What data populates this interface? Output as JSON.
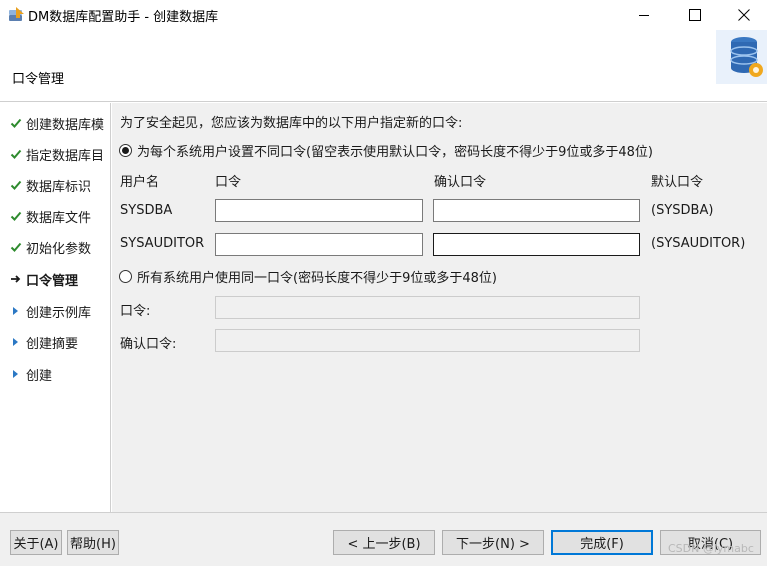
{
  "window": {
    "title": "DM数据库配置助手 - 创建数据库",
    "header_title": "口令管理"
  },
  "sidebar": {
    "steps": [
      {
        "label": "创建数据库模",
        "state": "done"
      },
      {
        "label": "指定数据库目",
        "state": "done"
      },
      {
        "label": "数据库标识",
        "state": "done"
      },
      {
        "label": "数据库文件",
        "state": "done"
      },
      {
        "label": "初始化参数",
        "state": "done"
      },
      {
        "label": "口令管理",
        "state": "current"
      },
      {
        "label": "创建示例库",
        "state": "pending"
      },
      {
        "label": "创建摘要",
        "state": "pending"
      },
      {
        "label": "创建",
        "state": "pending"
      }
    ]
  },
  "main": {
    "intro": "为了安全起见，您应该为数据库中的以下用户指定新的口令:",
    "option_individual": "为每个系统用户设置不同口令(留空表示使用默认口令，密码长度不得少于9位或多于48位)",
    "columns": {
      "username": "用户名",
      "password": "口令",
      "confirm": "确认口令",
      "default": "默认口令"
    },
    "users": [
      {
        "name": "SYSDBA",
        "password": "",
        "confirm": "",
        "default": "(SYSDBA)"
      },
      {
        "name": "SYSAUDITOR",
        "password": "",
        "confirm": "",
        "default": "(SYSAUDITOR)"
      }
    ],
    "option_shared": "所有系统用户使用同一口令(密码长度不得少于9位或多于48位)",
    "shared_password_label": "口令:",
    "shared_confirm_label": "确认口令:",
    "shared_password_value": "",
    "shared_confirm_value": ""
  },
  "footer": {
    "about": "关于(A)",
    "help": "帮助(H)",
    "back": "< 上一步(B)",
    "next": "下一步(N) >",
    "finish": "完成(F)",
    "cancel": "取消(C)",
    "watermark": "CSDN @lymabc"
  },
  "colors": {
    "accent": "#0078d7",
    "check": "#2e8b2e",
    "arrow_current": "#1a1a1a",
    "arrow_pending": "#2b78c4",
    "panel_bg": "#f0f0f0"
  },
  "icons": {
    "app": "database-wizard-icon",
    "header": "database-gear-logo",
    "done": "checkmark-icon",
    "current": "arrow-right-icon",
    "pending": "triangle-right-icon"
  }
}
